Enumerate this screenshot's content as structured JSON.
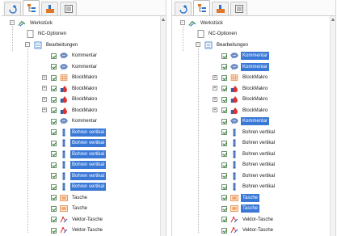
{
  "toolbar": {
    "buttons": [
      {
        "name": "add-operation-icon"
      },
      {
        "name": "tree-view-icon"
      },
      {
        "name": "machine-icon"
      },
      {
        "name": "list-view-icon"
      }
    ]
  },
  "root": {
    "label": "Werkstück"
  },
  "nc": {
    "label": "NC-Optionen"
  },
  "processing": {
    "label": "Bearbeitungen"
  },
  "left": {
    "items": [
      {
        "label": "Kommentar",
        "icon": "comment",
        "selected": false,
        "expander": false
      },
      {
        "label": "Kommentar",
        "icon": "comment",
        "selected": false,
        "expander": false
      },
      {
        "label": "BlockMakro",
        "icon": "blockmacro-grid",
        "selected": false,
        "expander": true
      },
      {
        "label": "BlockMakro",
        "icon": "blockmacro-drop",
        "selected": false,
        "expander": true
      },
      {
        "label": "BlockMakro",
        "icon": "blockmacro-drop",
        "selected": false,
        "expander": true
      },
      {
        "label": "BlockMakro",
        "icon": "blockmacro-drop",
        "selected": false,
        "expander": true
      },
      {
        "label": "Kommentar",
        "icon": "comment",
        "selected": false,
        "expander": false
      },
      {
        "label": "Bohren vertikal",
        "icon": "drill",
        "selected": true,
        "expander": false
      },
      {
        "label": "Bohren vertikal",
        "icon": "drill",
        "selected": true,
        "expander": false
      },
      {
        "label": "Bohren vertikal",
        "icon": "drill",
        "selected": true,
        "expander": false
      },
      {
        "label": "Bohren vertikal",
        "icon": "drill",
        "selected": true,
        "expander": false
      },
      {
        "label": "Bohren vertikal",
        "icon": "drill",
        "selected": true,
        "expander": false
      },
      {
        "label": "Bohren vertikal",
        "icon": "drill",
        "selected": true,
        "expander": false
      },
      {
        "label": "Tasche",
        "icon": "pocket",
        "selected": false,
        "expander": false
      },
      {
        "label": "Tasche",
        "icon": "pocket",
        "selected": false,
        "expander": false
      },
      {
        "label": "Vektor-Tasche",
        "icon": "vector-pocket",
        "selected": false,
        "expander": false
      },
      {
        "label": "Vektor-Tasche",
        "icon": "vector-pocket",
        "selected": false,
        "expander": false
      }
    ]
  },
  "right": {
    "items": [
      {
        "label": "Kommentar",
        "icon": "comment",
        "selected": true,
        "expander": false
      },
      {
        "label": "Kommentar",
        "icon": "comment",
        "selected": true,
        "expander": false
      },
      {
        "label": "BlockMakro",
        "icon": "blockmacro-grid",
        "selected": false,
        "expander": true
      },
      {
        "label": "BlockMakro",
        "icon": "blockmacro-drop",
        "selected": false,
        "expander": true
      },
      {
        "label": "BlockMakro",
        "icon": "blockmacro-drop",
        "selected": false,
        "expander": true
      },
      {
        "label": "BlockMakro",
        "icon": "blockmacro-drop",
        "selected": false,
        "expander": true
      },
      {
        "label": "Kommentar",
        "icon": "comment",
        "selected": true,
        "expander": false
      },
      {
        "label": "Bohren vertikal",
        "icon": "drill",
        "selected": false,
        "expander": false
      },
      {
        "label": "Bohren vertikal",
        "icon": "drill",
        "selected": false,
        "expander": false
      },
      {
        "label": "Bohren vertikal",
        "icon": "drill",
        "selected": false,
        "expander": false
      },
      {
        "label": "Bohren vertikal",
        "icon": "drill",
        "selected": false,
        "expander": false
      },
      {
        "label": "Bohren vertikal",
        "icon": "drill",
        "selected": false,
        "expander": false
      },
      {
        "label": "Bohren vertikal",
        "icon": "drill",
        "selected": false,
        "expander": false
      },
      {
        "label": "Tasche",
        "icon": "pocket",
        "selected": true,
        "expander": false
      },
      {
        "label": "Tasche",
        "icon": "pocket",
        "selected": true,
        "expander": false
      },
      {
        "label": "Vektor-Tasche",
        "icon": "vector-pocket",
        "selected": false,
        "expander": false
      },
      {
        "label": "Vektor-Tasche",
        "icon": "vector-pocket",
        "selected": false,
        "expander": false
      }
    ]
  },
  "colors": {
    "selection": "#3a78d6",
    "check": "#2e7d32",
    "accent_orange": "#e0782a"
  }
}
